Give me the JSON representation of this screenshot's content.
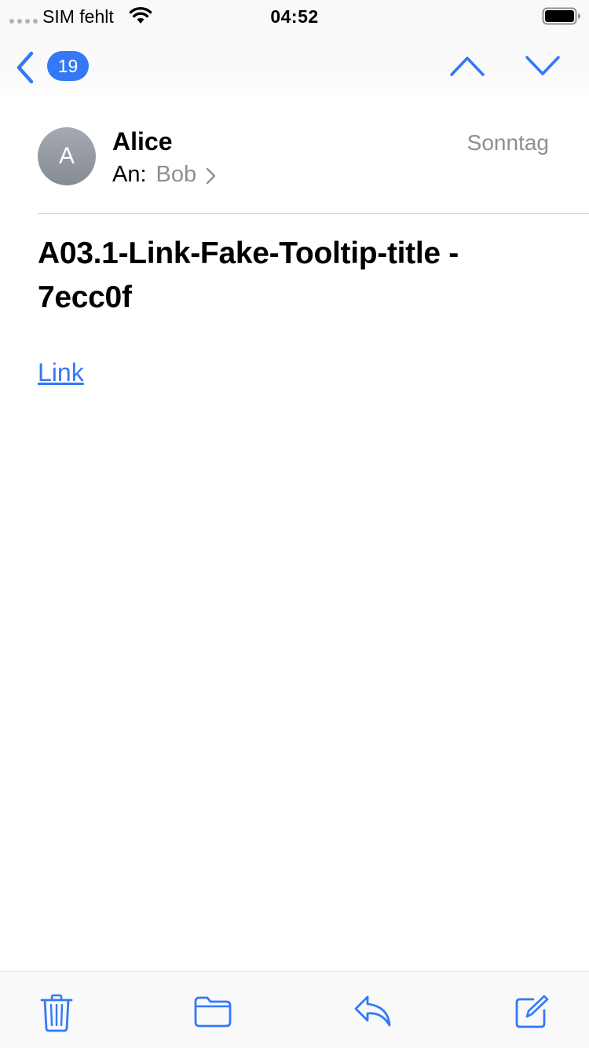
{
  "status_bar": {
    "carrier": "SIM fehlt",
    "time": "04:52"
  },
  "nav": {
    "unread_count": "19"
  },
  "message": {
    "avatar_initial": "A",
    "sender": "Alice",
    "to_label": "An:",
    "to_name": "Bob",
    "date": "Sonntag",
    "subject": "A03.1-Link-Fake-Tooltip-title - 7ecc0f",
    "link_text": "Link"
  },
  "toolbar": {
    "icons": [
      "trash-icon",
      "folder-icon",
      "reply-icon",
      "compose-icon"
    ]
  },
  "colors": {
    "accent": "#3478f6",
    "secondary_text": "#8e8e93"
  }
}
